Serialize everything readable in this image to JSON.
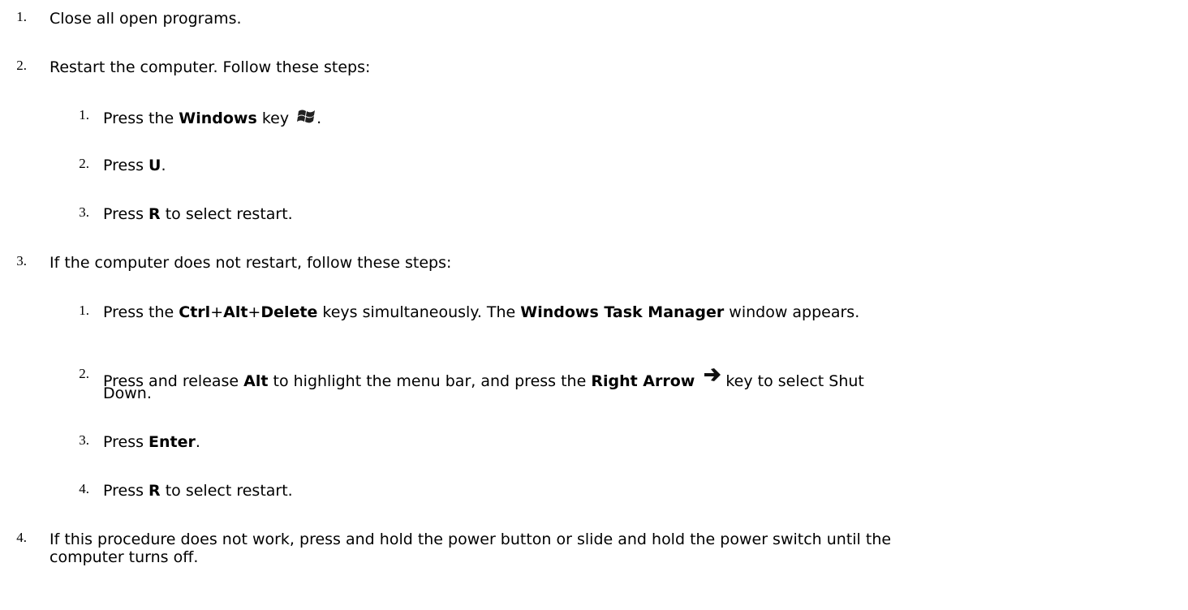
{
  "steps": [
    {
      "number": "1.",
      "text": "Close all open programs."
    },
    {
      "number": "2.",
      "text": "Restart the computer. Follow these steps:",
      "substeps": [
        {
          "number": "1.",
          "pre": "Press the ",
          "bold": "Windows",
          "post": " key",
          "icon": "windows-logo-icon",
          "after": "."
        },
        {
          "number": "2.",
          "pre": "Press ",
          "bold": "U",
          "post": "."
        },
        {
          "number": "3.",
          "pre": "Press ",
          "bold": "R",
          "post": " to select restart."
        }
      ]
    },
    {
      "number": "3.",
      "text": "If the computer does not restart, follow these steps:",
      "substeps": [
        {
          "number": "1.",
          "parts": [
            "Press the ",
            "Ctrl",
            "+",
            "Alt",
            "+",
            "Delete",
            " keys simultaneously. The ",
            "Windows Task Manager",
            " window appears."
          ]
        },
        {
          "number": "2.",
          "parts": [
            "Press and release ",
            "Alt",
            " to highlight the menu bar, and press the ",
            "Right Arrow",
            "key to select Shut",
            "Down."
          ],
          "icon": "right-arrow-icon"
        },
        {
          "number": "3.",
          "pre": "Press ",
          "bold": "Enter",
          "post": "."
        },
        {
          "number": "4.",
          "pre": "Press ",
          "bold": "R",
          "post": " to select restart."
        }
      ]
    },
    {
      "number": "4.",
      "text": "If this procedure does not work, press and hold the power button or slide and hold the power switch until the",
      "text_cont": "computer turns off."
    }
  ]
}
